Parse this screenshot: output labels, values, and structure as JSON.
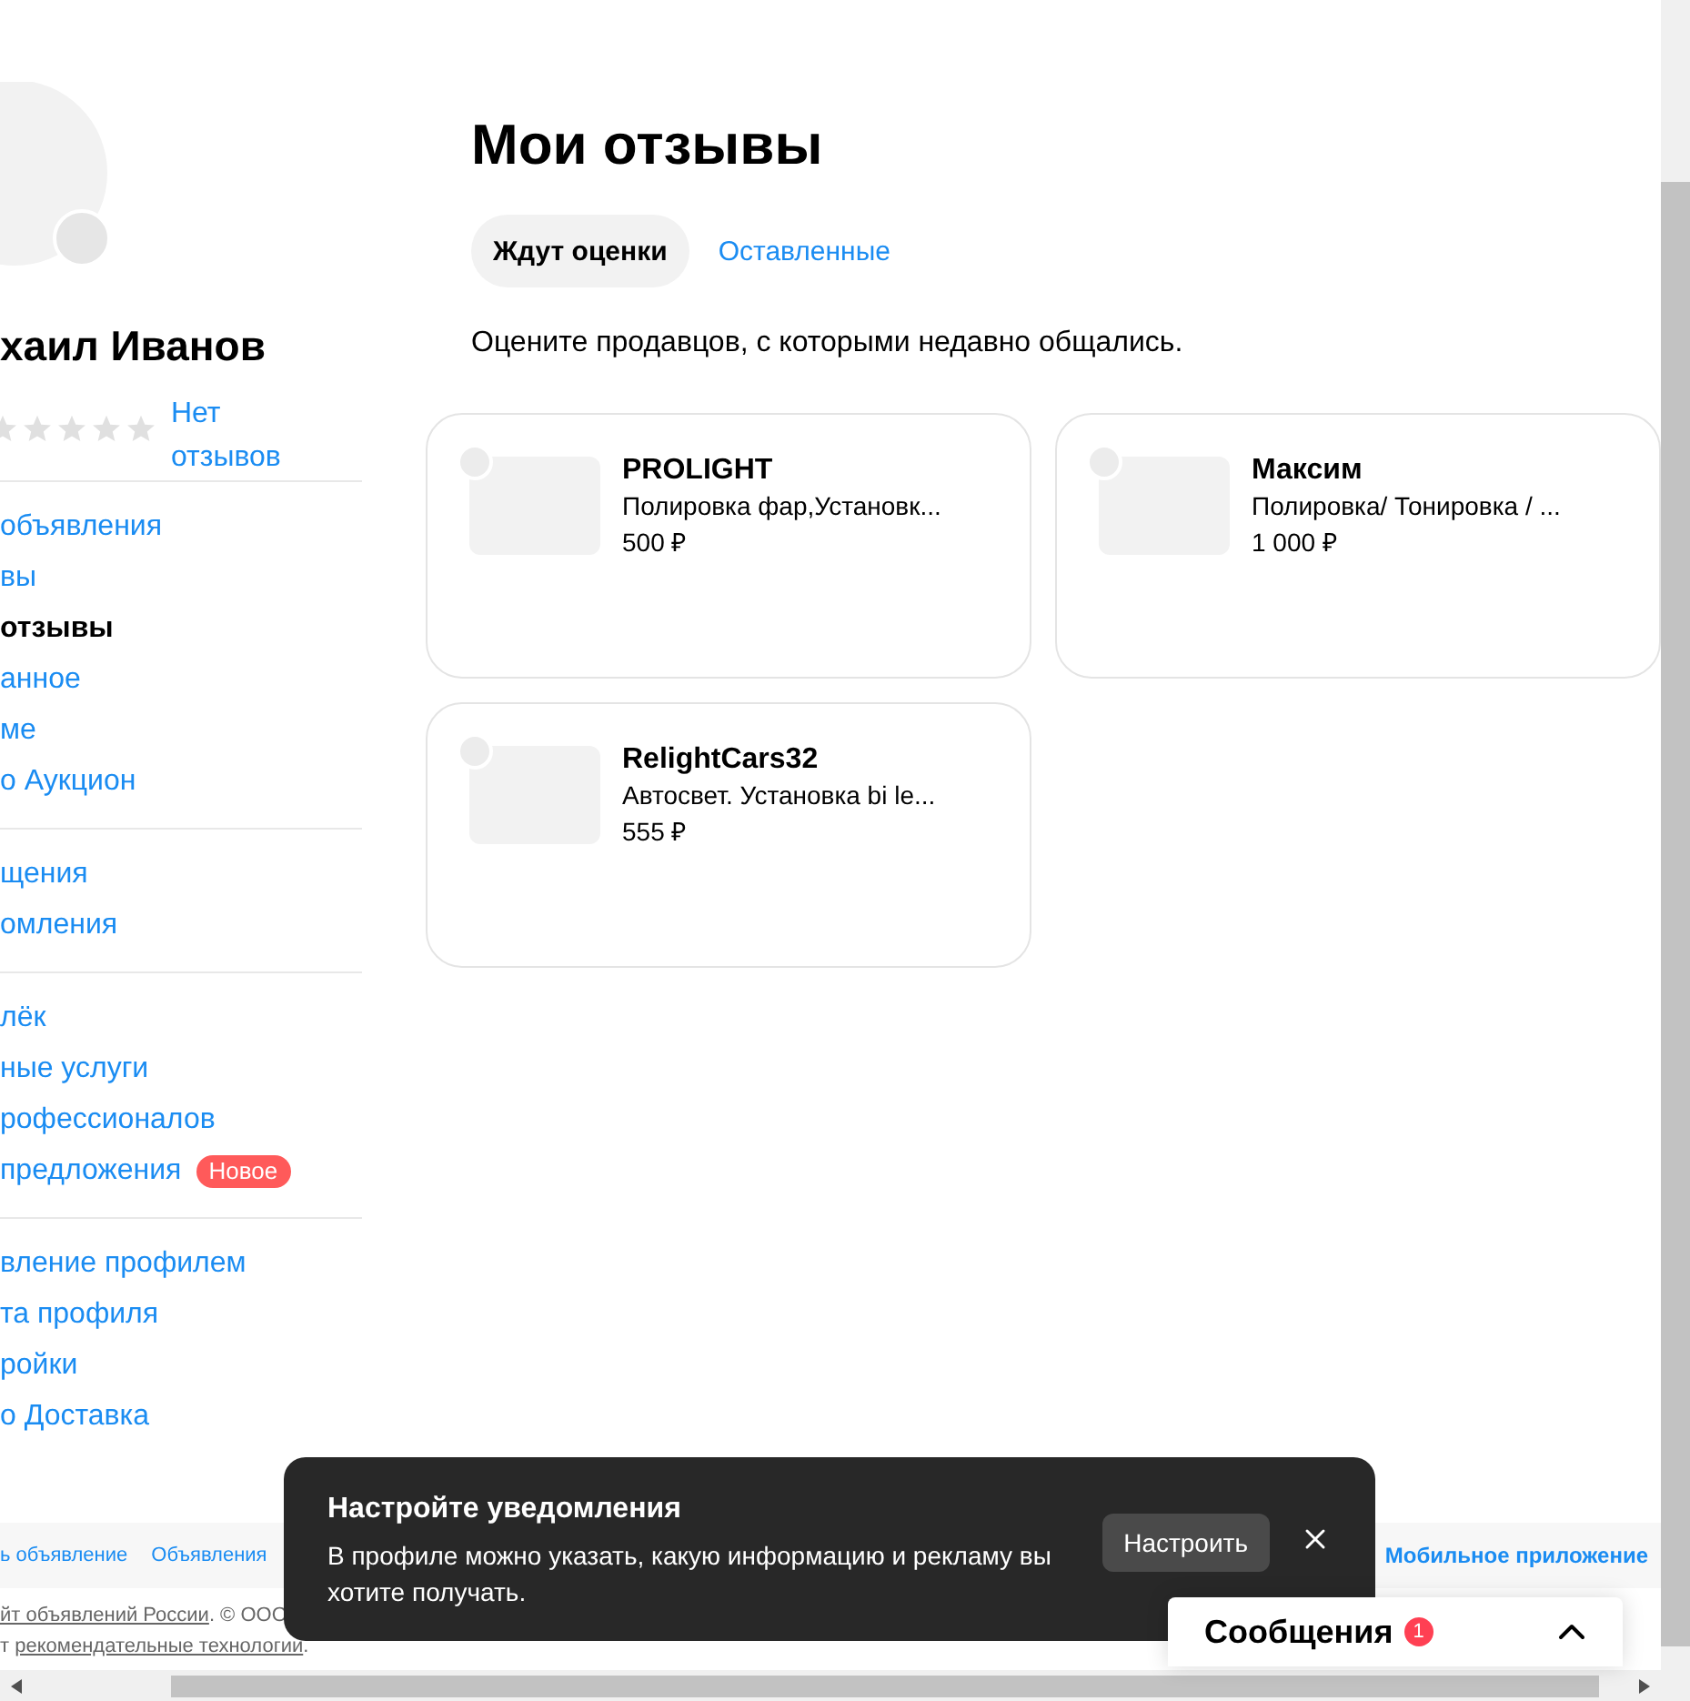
{
  "profile": {
    "name": "хаил Иванов",
    "stars": 0,
    "reviews_link": "Нет отзывов"
  },
  "sidebar": {
    "groups": [
      {
        "items": [
          {
            "label": "объявления",
            "selected": false
          },
          {
            "label": "вы",
            "selected": false
          },
          {
            "label": "отзывы",
            "selected": true
          },
          {
            "label": "анное",
            "selected": false
          },
          {
            "label": "ме",
            "selected": false
          },
          {
            "label": "о Аукцион",
            "selected": false
          }
        ]
      },
      {
        "items": [
          {
            "label": "щения",
            "selected": false
          },
          {
            "label": "омления",
            "selected": false
          }
        ]
      },
      {
        "items": [
          {
            "label": "лёк",
            "selected": false
          },
          {
            "label": "ные услуги",
            "selected": false
          },
          {
            "label": "рофессионалов",
            "selected": false
          },
          {
            "label": "предложения",
            "selected": false,
            "badge": "Новое"
          }
        ]
      },
      {
        "items": [
          {
            "label": "вление профилем",
            "selected": false
          },
          {
            "label": "та профиля",
            "selected": false
          },
          {
            "label": "ройки",
            "selected": false
          },
          {
            "label": "о Доставка",
            "selected": false
          }
        ]
      }
    ]
  },
  "main": {
    "title": "Мои отзывы",
    "tabs": [
      {
        "label": "Ждут оценки",
        "selected": true
      },
      {
        "label": "Оставленные",
        "selected": false
      }
    ],
    "subtitle": "Оцените продавцов, с которыми недавно общались.",
    "cards": [
      {
        "title": "PROLIGHT",
        "description": "Полировка фар,Установк...",
        "price": "500 ₽"
      },
      {
        "title": "Максим",
        "description": "Полировка/ Тонировка / ...",
        "price": "1 000 ₽"
      },
      {
        "title": "RelightCars32",
        "description": "Автосвет. Установка bi le...",
        "price": "555 ₽"
      }
    ]
  },
  "footer": {
    "links": [
      "ь объявление",
      "Объявления"
    ],
    "right_link": "Мобильное приложение",
    "legal": [
      {
        "link": "йт объявлений России",
        "rest": ". © ООО"
      },
      {
        "prefix": "т ",
        "link": "рекомендательные технологии",
        "rest": "."
      }
    ]
  },
  "toast": {
    "title": "Настройте уведомления",
    "text": "В профиле можно указать, какую информацию и рекламу вы хотите получать.",
    "button": "Настроить"
  },
  "messages": {
    "label": "Сообщения",
    "badge": "1"
  }
}
